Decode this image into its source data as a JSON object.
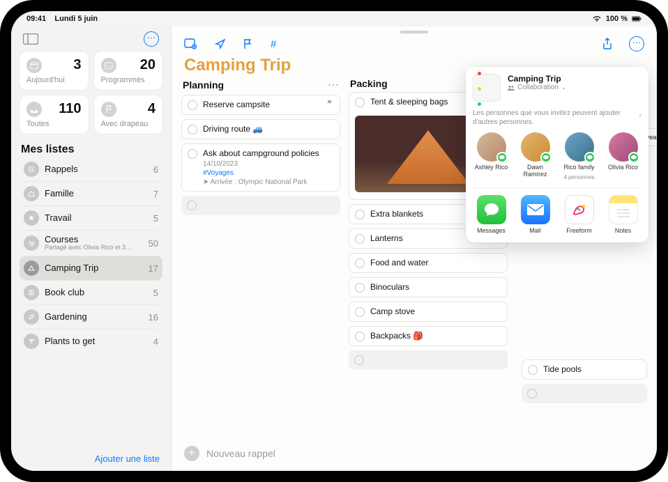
{
  "status": {
    "time": "09:41",
    "date": "Lundi 5 juin",
    "battery": "100 %"
  },
  "sidebar": {
    "cards": [
      {
        "label": "Aujourd'hui",
        "count": "3"
      },
      {
        "label": "Programmés",
        "count": "20"
      },
      {
        "label": "Toutes",
        "count": "110"
      },
      {
        "label": "Avec drapeau",
        "count": "4"
      }
    ],
    "my_lists_title": "Mes listes",
    "lists": [
      {
        "name": "Rappels",
        "count": "6"
      },
      {
        "name": "Famille",
        "count": "7"
      },
      {
        "name": "Travail",
        "count": "5"
      },
      {
        "name": "Courses",
        "sub": "Partagé avec Olivia Rico et 3…",
        "count": "50"
      },
      {
        "name": "Camping Trip",
        "count": "17"
      },
      {
        "name": "Book club",
        "count": "5"
      },
      {
        "name": "Gardening",
        "count": "16"
      },
      {
        "name": "Plants to get",
        "count": "4"
      }
    ],
    "add_list": "Ajouter une liste"
  },
  "main": {
    "title": "Camping Trip",
    "columns": {
      "planning": {
        "title": "Planning",
        "tasks": [
          {
            "text": "Reserve campsite",
            "flag": true
          },
          {
            "text": "Driving route 🚙"
          },
          {
            "text": "Ask about campground policies",
            "meta_date": "14/10/2023",
            "meta_tag": "#Voyages",
            "meta_loc": "Arrivée : Olympic National Park"
          }
        ]
      },
      "packing": {
        "title": "Packing",
        "tasks": [
          {
            "text": "Tent & sleeping bags"
          },
          {
            "text": "Extra blankets"
          },
          {
            "text": "Lanterns"
          },
          {
            "text": "Food and water"
          },
          {
            "text": "Binoculars"
          },
          {
            "text": "Camp stove"
          },
          {
            "text": "Backpacks 🎒"
          }
        ]
      },
      "visits": {
        "under_task": "Tide pools"
      }
    },
    "new_reminder": "Nouveau rappel",
    "peek": "vea"
  },
  "share": {
    "title": "Camping Trip",
    "subtitle": "Collaboration",
    "note": "Les personnes que vous invitez peuvent ajouter d'autres personnes.",
    "contacts": [
      {
        "name": "Ashley Rico"
      },
      {
        "name": "Dawn Ramírez"
      },
      {
        "name": "Rico family",
        "sub": "4 personnes"
      },
      {
        "name": "Olivia Rico"
      }
    ],
    "apps": [
      {
        "name": "Messages"
      },
      {
        "name": "Mail"
      },
      {
        "name": "Freeform"
      },
      {
        "name": "Notes"
      }
    ]
  }
}
